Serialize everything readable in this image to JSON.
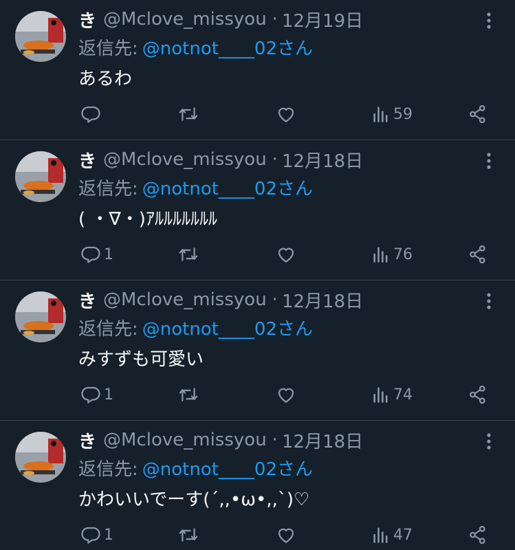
{
  "tweets": [
    {
      "name": "き",
      "handle": "@Mclove_missyou",
      "separator": "·",
      "date": "12月19日",
      "reply_prefix": "返信先:",
      "reply_to": "@notnot____02さん",
      "text": "あるわ",
      "reply_count": "",
      "views": "59"
    },
    {
      "name": "き",
      "handle": "@Mclove_missyou",
      "separator": "·",
      "date": "12月18日",
      "reply_prefix": "返信先:",
      "reply_to": "@notnot____02さん",
      "text": "( ・∇・)ｱﾙﾙﾙﾙﾙﾙﾙ",
      "reply_count": "1",
      "views": "76"
    },
    {
      "name": "き",
      "handle": "@Mclove_missyou",
      "separator": "·",
      "date": "12月18日",
      "reply_prefix": "返信先:",
      "reply_to": "@notnot____02さん",
      "text": "みすずも可愛い",
      "reply_count": "1",
      "views": "74"
    },
    {
      "name": "き",
      "handle": "@Mclove_missyou",
      "separator": "·",
      "date": "12月18日",
      "reply_prefix": "返信先:",
      "reply_to": "@notnot____02さん",
      "text": "かわいいでーす(´,,•ω•,,`)♡",
      "reply_count": "1",
      "views": "47"
    }
  ],
  "icons": {
    "more": "more-vertical-icon",
    "reply": "reply-icon",
    "retweet": "retweet-icon",
    "like": "heart-icon",
    "views": "views-icon",
    "share": "share-icon"
  },
  "colors": {
    "background": "#15202b",
    "divider": "#38444d",
    "text": "#f7f9f9",
    "muted": "#8b98a5",
    "link": "#1d9bf0"
  }
}
